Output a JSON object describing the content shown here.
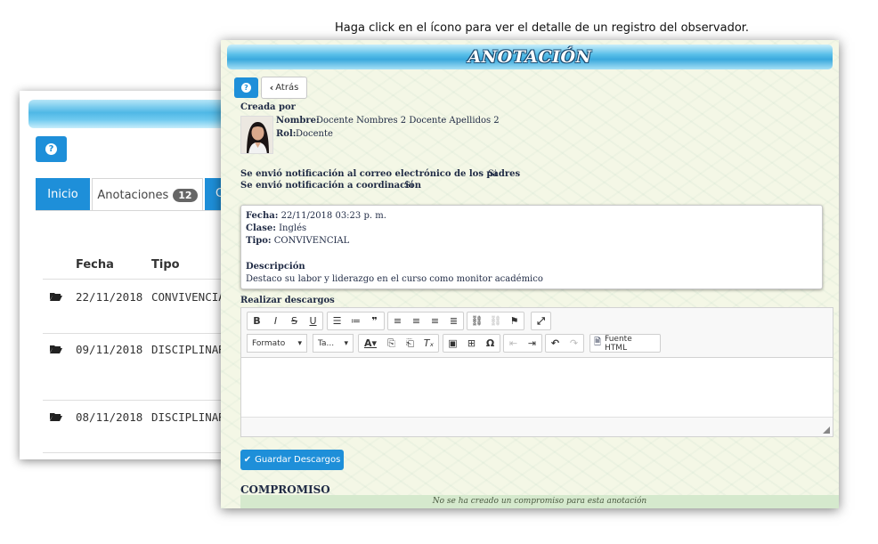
{
  "caption": "Haga click en el ícono para ver el detalle de un registro del observador.",
  "back": {
    "tabs": {
      "inicio": "Inicio",
      "anotaciones": "Anotaciones",
      "anotaciones_count": "12",
      "third": "C"
    },
    "headers": {
      "fecha": "Fecha",
      "tipo": "Tipo"
    },
    "rows": [
      {
        "fecha": "22/11/2018",
        "tipo": "CONVIVENCIAL"
      },
      {
        "fecha": "09/11/2018",
        "tipo": "DISCIPLINARIO"
      },
      {
        "fecha": "08/11/2018",
        "tipo": "DISCIPLINARIO"
      }
    ]
  },
  "front": {
    "title": "ANOTACIÓN",
    "back_label": "Atrás",
    "created_by": "Creada por",
    "nombre_label": "Nombre:",
    "nombre_value": "Docente Nombres 2 Docente Apellidos 2",
    "rol_label": "Rol:",
    "rol_value": "Docente",
    "notif_padres_label": "Se envió notificación al correo electrónico de los padres",
    "notif_padres_value": "Si",
    "notif_coord_label": "Se envió notificación a coordinación",
    "notif_coord_value": "Si",
    "detail": {
      "fecha_label": "Fecha:",
      "fecha_value": "22/11/2018 03:23 p. m.",
      "clase_label": "Clase:",
      "clase_value": "Inglés",
      "tipo_label": "Tipo:",
      "tipo_value": "CONVIVENCIAL",
      "descripcion_label": "Descripción",
      "descripcion_value": "Destaco su labor y liderazgo en el curso como monitor académico"
    },
    "descargos_label": "Realizar descargos",
    "toolbar": {
      "formato": "Formato",
      "tamano": "Ta...",
      "fuente_html": "Fuente HTML"
    },
    "save_label": "Guardar Descargos",
    "compromiso_title": "COMPROMISO",
    "compromiso_empty": "No se ha creado un compromiso para esta anotación"
  }
}
